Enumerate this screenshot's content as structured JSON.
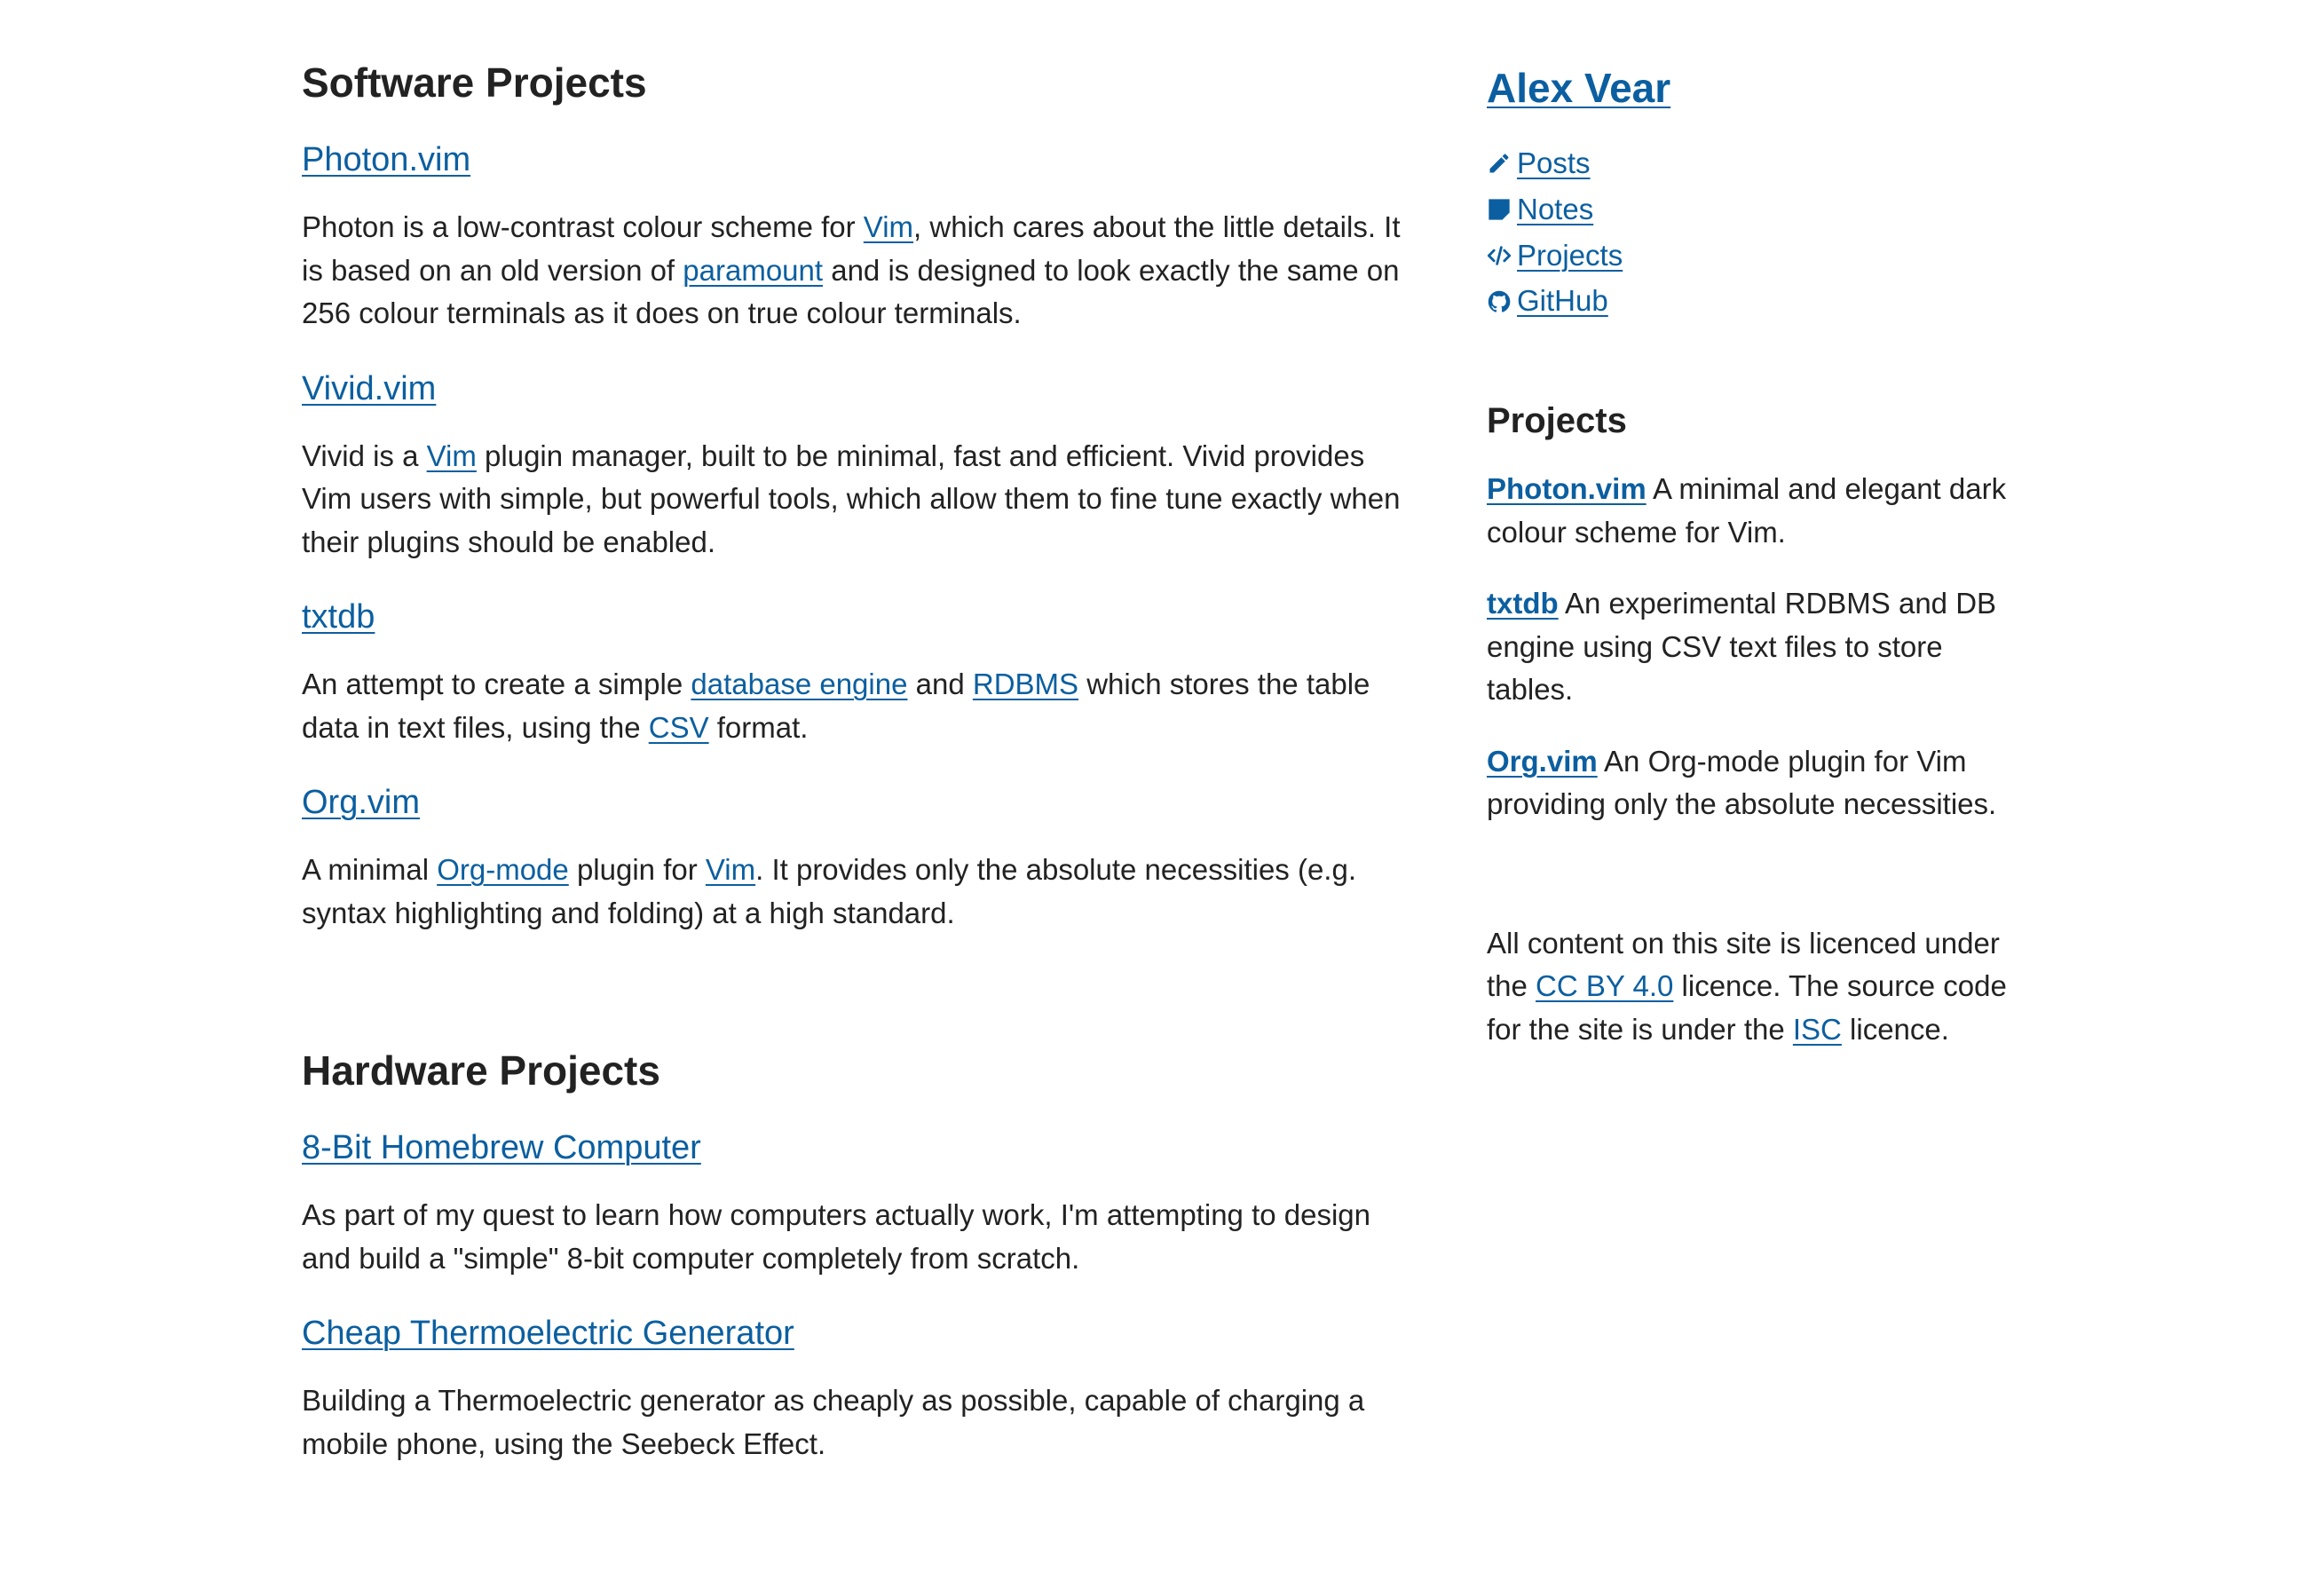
{
  "software": {
    "heading": "Software Projects",
    "photon": {
      "title": "Photon.vim",
      "t1": "Photon is a low-contrast colour scheme for ",
      "link1": "Vim",
      "t2": ", which cares about the little details. It is based on an old version of ",
      "link2": "paramount",
      "t3": " and is designed to look exactly the same on 256 colour terminals as it does on true colour terminals."
    },
    "vivid": {
      "title": "Vivid.vim",
      "t1": "Vivid is a ",
      "link1": "Vim",
      "t2": " plugin manager, built to be minimal, fast and efficient. Vivid provides Vim users with simple, but powerful tools, which allow them to fine tune exactly when their plugins should be enabled."
    },
    "txtdb": {
      "title": "txtdb",
      "t1": "An attempt to create a simple ",
      "link1": "database engine",
      "t2": " and ",
      "link2": "RDBMS",
      "t3": " which stores the table data in text files, using the ",
      "link3": "CSV",
      "t4": " format."
    },
    "org": {
      "title": "Org.vim",
      "t1": "A minimal ",
      "link1": "Org-mode",
      "t2": " plugin for ",
      "link2": "Vim",
      "t3": ". It provides only the absolute necessities (e.g. syntax highlighting and folding) at a high standard."
    }
  },
  "hardware": {
    "heading": "Hardware Projects",
    "homebrew": {
      "title": "8-Bit Homebrew Computer",
      "text": "As part of my quest to learn how computers actually work, I'm attempting to design and build a \"simple\" 8-bit computer completely from scratch."
    },
    "teg": {
      "title": "Cheap Thermoelectric Generator",
      "text": "Building a Thermoelectric generator as cheaply as possible, capable of charging a mobile phone, using the Seebeck Effect."
    }
  },
  "sidebar": {
    "site_title": "Alex Vear",
    "nav": {
      "posts": "Posts",
      "notes": "Notes",
      "projects": "Projects",
      "github": "GitHub"
    },
    "projects_heading": "Projects",
    "items": [
      {
        "name": "Photon.vim",
        "desc": " A minimal and elegant dark colour scheme for Vim."
      },
      {
        "name": "txtdb",
        "desc": " An experimental RDBMS and DB engine using CSV text files to store tables."
      },
      {
        "name": "Org.vim",
        "desc": " An Org-mode plugin for Vim providing only the absolute necessities."
      }
    ],
    "licence": {
      "t1": "All content on this site is licenced under the ",
      "link1": "CC BY 4.0",
      "t2": " licence. The source code for the site is under the ",
      "link2": "ISC",
      "t3": " licence."
    }
  },
  "colors": {
    "link": "#0b5fa0",
    "text": "#222222",
    "background": "#ffffff"
  }
}
